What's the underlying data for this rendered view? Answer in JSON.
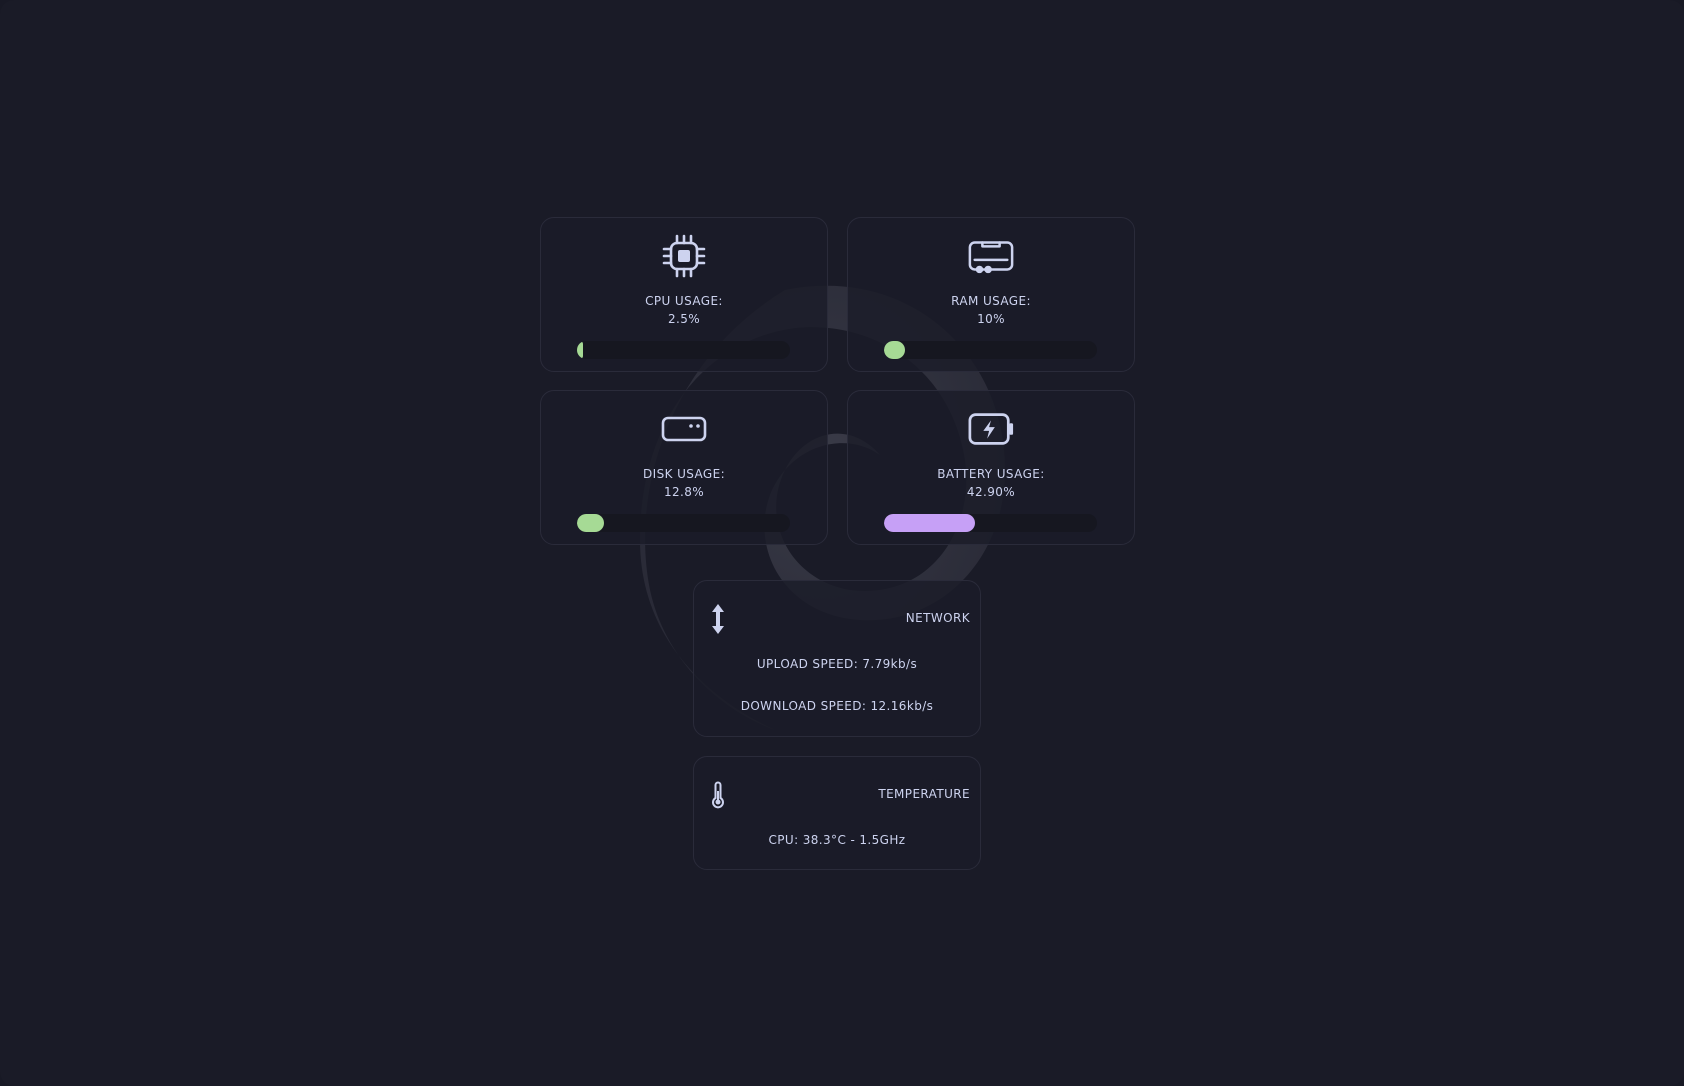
{
  "colors": {
    "background": "#1a1b27",
    "card": "#1b1c28",
    "text": "#cdd3ef",
    "bar_green": "#a6da95",
    "bar_purple": "#c6a0f6",
    "bar_track": "#161720"
  },
  "cpu": {
    "icon": "cpu-chip-icon",
    "label": "CPU USAGE:",
    "value": "2.5%",
    "fraction": 0.025
  },
  "ram": {
    "icon": "ram-memory-icon",
    "label": "RAM USAGE:",
    "value": "10%",
    "fraction": 0.1
  },
  "disk": {
    "icon": "hard-drive-icon",
    "label": "DISK USAGE:",
    "value": "12.8%",
    "fraction": 0.128
  },
  "battery": {
    "icon": "battery-charging-icon",
    "label": "BATTERY USAGE:",
    "value": "42.90%",
    "fraction": 0.429
  },
  "network": {
    "icon": "up-down-arrow-icon",
    "title": "NETWORK",
    "upload": "UPLOAD SPEED: 7.79kb/s",
    "download": "DOWNLOAD SPEED: 12.16kb/s"
  },
  "temperature": {
    "icon": "thermometer-icon",
    "title": "TEMPERATURE",
    "cpu": "CPU: 38.3°C - 1.5GHz"
  }
}
